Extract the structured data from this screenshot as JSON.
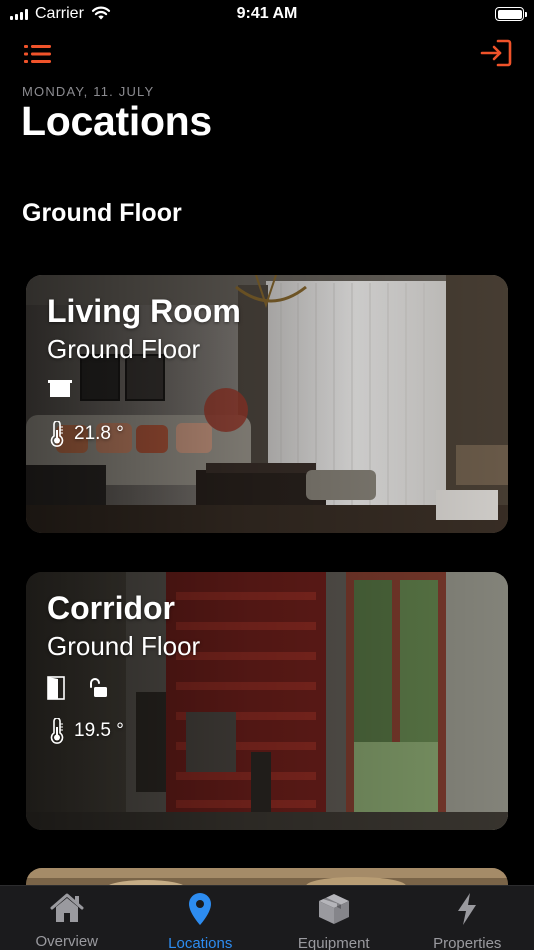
{
  "status_bar": {
    "carrier": "Carrier",
    "time": "9:41 AM"
  },
  "header": {
    "date": "MONDAY, 11. JULY",
    "title": "Locations",
    "menu_icon": "list-icon",
    "logout_icon": "sign-in-icon"
  },
  "section": {
    "title": "Ground Floor"
  },
  "locations": [
    {
      "name": "Living Room",
      "floor": "Ground Floor",
      "devices": [
        "blind-icon"
      ],
      "temperature": "21.8 °"
    },
    {
      "name": "Corridor",
      "floor": "Ground Floor",
      "devices": [
        "door-icon",
        "unlocked-icon"
      ],
      "temperature": "19.5 °"
    }
  ],
  "tab_bar": {
    "tabs": [
      {
        "label": "Overview",
        "icon": "house-icon",
        "active": false
      },
      {
        "label": "Locations",
        "icon": "location-pin-icon",
        "active": true
      },
      {
        "label": "Equipment",
        "icon": "box-icon",
        "active": false
      },
      {
        "label": "Properties",
        "icon": "bolt-icon",
        "active": false
      }
    ]
  },
  "colors": {
    "accent": "#f0532a",
    "active_tab": "#2d8cf0",
    "inactive_tab": "#9a9a9f",
    "background": "#000000"
  }
}
